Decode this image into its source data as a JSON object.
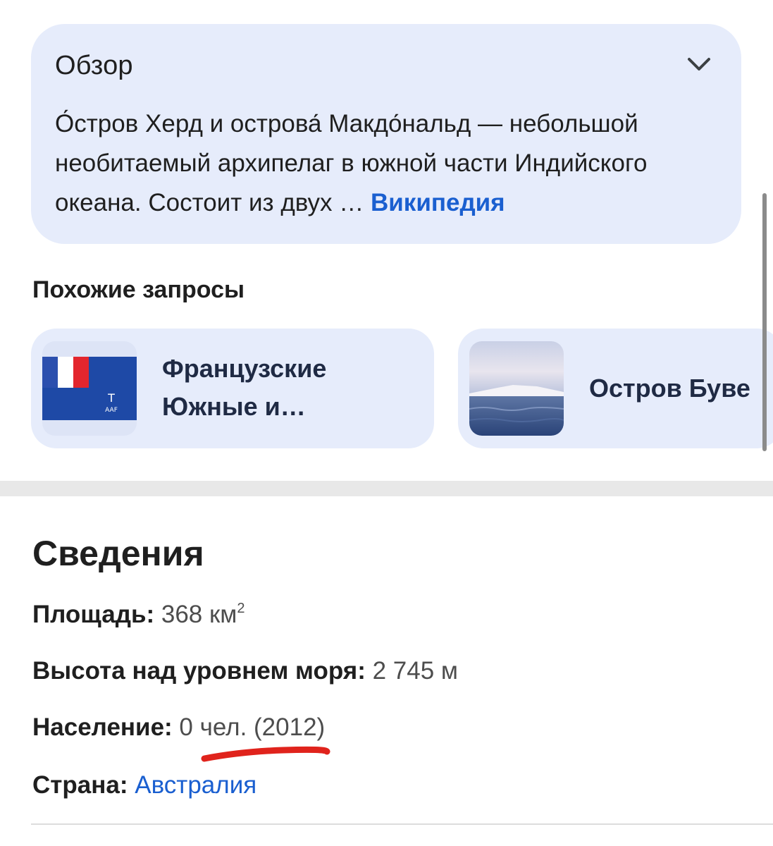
{
  "overview": {
    "title": "Обзор",
    "text": "О́стров Херд и острова́ Макдо́нальд — небольшой необитаемый архипелаг в южной части Индийского океана. Состоит из двух … ",
    "source_link": "Википедия",
    "toggle_icon": "chevron-down-icon"
  },
  "related": {
    "heading": "Похожие запросы",
    "items": [
      {
        "label": "Французские Южные и…",
        "thumb": "flag-french-southern-lands"
      },
      {
        "label": "Остров Буве",
        "thumb": "sea-island-photo"
      }
    ]
  },
  "facts": {
    "title": "Сведения",
    "area_label": "Площадь:",
    "area_value": "368 км",
    "area_sup": "2",
    "height_label": "Высота над уровнем моря:",
    "height_value": "2 745 м",
    "population_label": "Население:",
    "population_value": "0 чел. (2012)",
    "country_label": "Страна:",
    "country_value": "Австралия"
  },
  "colors": {
    "card_bg": "#e6ecfb",
    "link": "#1a5fd0",
    "annotation": "#e0231c"
  }
}
